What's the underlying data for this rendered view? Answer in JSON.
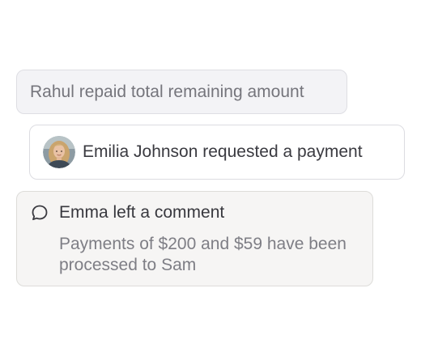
{
  "feed": {
    "repaid": {
      "text": "Rahul repaid total remaining amount"
    },
    "request": {
      "avatar": "user-photo-avatar",
      "text": "Emilia Johnson requested a payment"
    },
    "comment": {
      "icon": "chat-bubble-icon",
      "title": "Emma left a comment",
      "body": "Payments of $200 and $59 have been processed to Sam"
    }
  },
  "colors": {
    "muted_card_bg": "#f3f3f6",
    "comment_card_bg": "#f6f5f4",
    "primary_text": "#3a3a40",
    "muted_text": "#75757c"
  }
}
